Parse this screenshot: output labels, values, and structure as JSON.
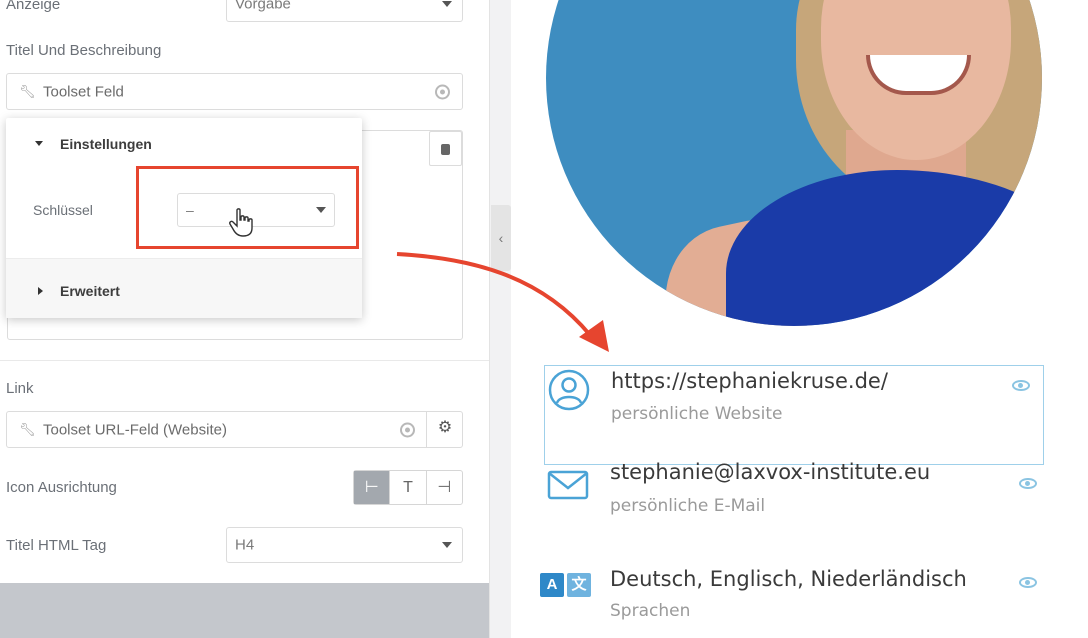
{
  "editor": {
    "anzeige": {
      "label": "Anzeige",
      "value": "Vorgabe"
    },
    "title_description": {
      "label": "Titel Und Beschreibung",
      "field_value": "Toolset Feld"
    },
    "popup": {
      "einstellungen_label": "Einstellungen",
      "schluessel_label": "Schlüssel",
      "schluessel_value": "–",
      "erweitert_label": "Erweitert"
    },
    "link": {
      "label": "Link",
      "field_value": "Toolset URL-Feld (Website)"
    },
    "icon_alignment": {
      "label": "Icon Ausrichtung",
      "options": [
        "⊢",
        "T",
        "⊣"
      ]
    },
    "title_html_tag": {
      "label": "Titel HTML Tag",
      "value": "H4"
    }
  },
  "preview": {
    "items": [
      {
        "title": "https://stephaniekruse.de/",
        "subtitle": "persönliche Website",
        "icon": "person-circle-icon"
      },
      {
        "title": "stephanie@laxvox-institute.eu",
        "subtitle": "persönliche E-Mail",
        "icon": "envelope-icon"
      },
      {
        "title": "Deutsch, Englisch, Niederländisch",
        "subtitle": "Sprachen",
        "icon": "translate-icon"
      }
    ],
    "translate_icon_letters": [
      "A",
      "文"
    ]
  },
  "colors": {
    "accent_red": "#e6452f",
    "icon_blue": "#4aa3d6",
    "selection_border": "#9fd0ea",
    "photo_background": "#3e8dc0"
  }
}
